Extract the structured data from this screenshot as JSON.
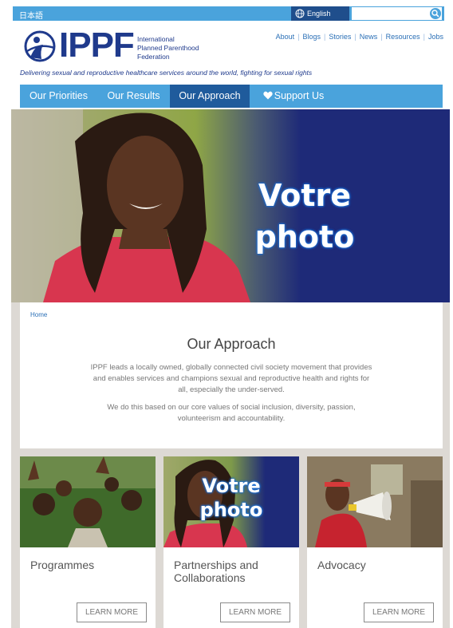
{
  "topbar": {
    "language_link": "日本語",
    "language_select": "English",
    "search_placeholder": ""
  },
  "header": {
    "logo": "IPPF",
    "logo_subtitle": [
      "International",
      "Planned Parenthood",
      "Federation"
    ],
    "utility_links": [
      "About",
      "Blogs",
      "Stories",
      "News",
      "Resources",
      "Jobs"
    ],
    "tagline": "Delivering sexual and reproductive healthcare services around the world, fighting for sexual rights"
  },
  "nav": {
    "items": [
      "Our Priorities",
      "Our Results",
      "Our Approach",
      "Support Us"
    ],
    "active": "Our Approach"
  },
  "hero": {
    "overlay": [
      "Votre",
      "photo"
    ]
  },
  "main": {
    "breadcrumb": "Home",
    "title": "Our Approach",
    "paragraphs": [
      "IPPF leads a locally owned, globally connected civil society movement that provides and enables services and champions sexual and reproductive health and rights for all, especially the under-served.",
      "We do this based on our core values of social inclusion, diversity, passion, volunteerism and accountability."
    ]
  },
  "cards": [
    {
      "title": "Programmes",
      "button": "LEARN MORE"
    },
    {
      "title": "Partnerships and Collaborations",
      "button": "LEARN MORE",
      "overlay": [
        "Votre",
        "photo"
      ]
    },
    {
      "title": "Advocacy",
      "button": "LEARN MORE"
    }
  ],
  "colors": {
    "nav_blue": "#4aa3dc",
    "nav_active": "#1f5b9c",
    "brand_navy": "#1f3a8c",
    "hero_navy": "#1e2a78",
    "link_blue": "#2a6fb6"
  }
}
